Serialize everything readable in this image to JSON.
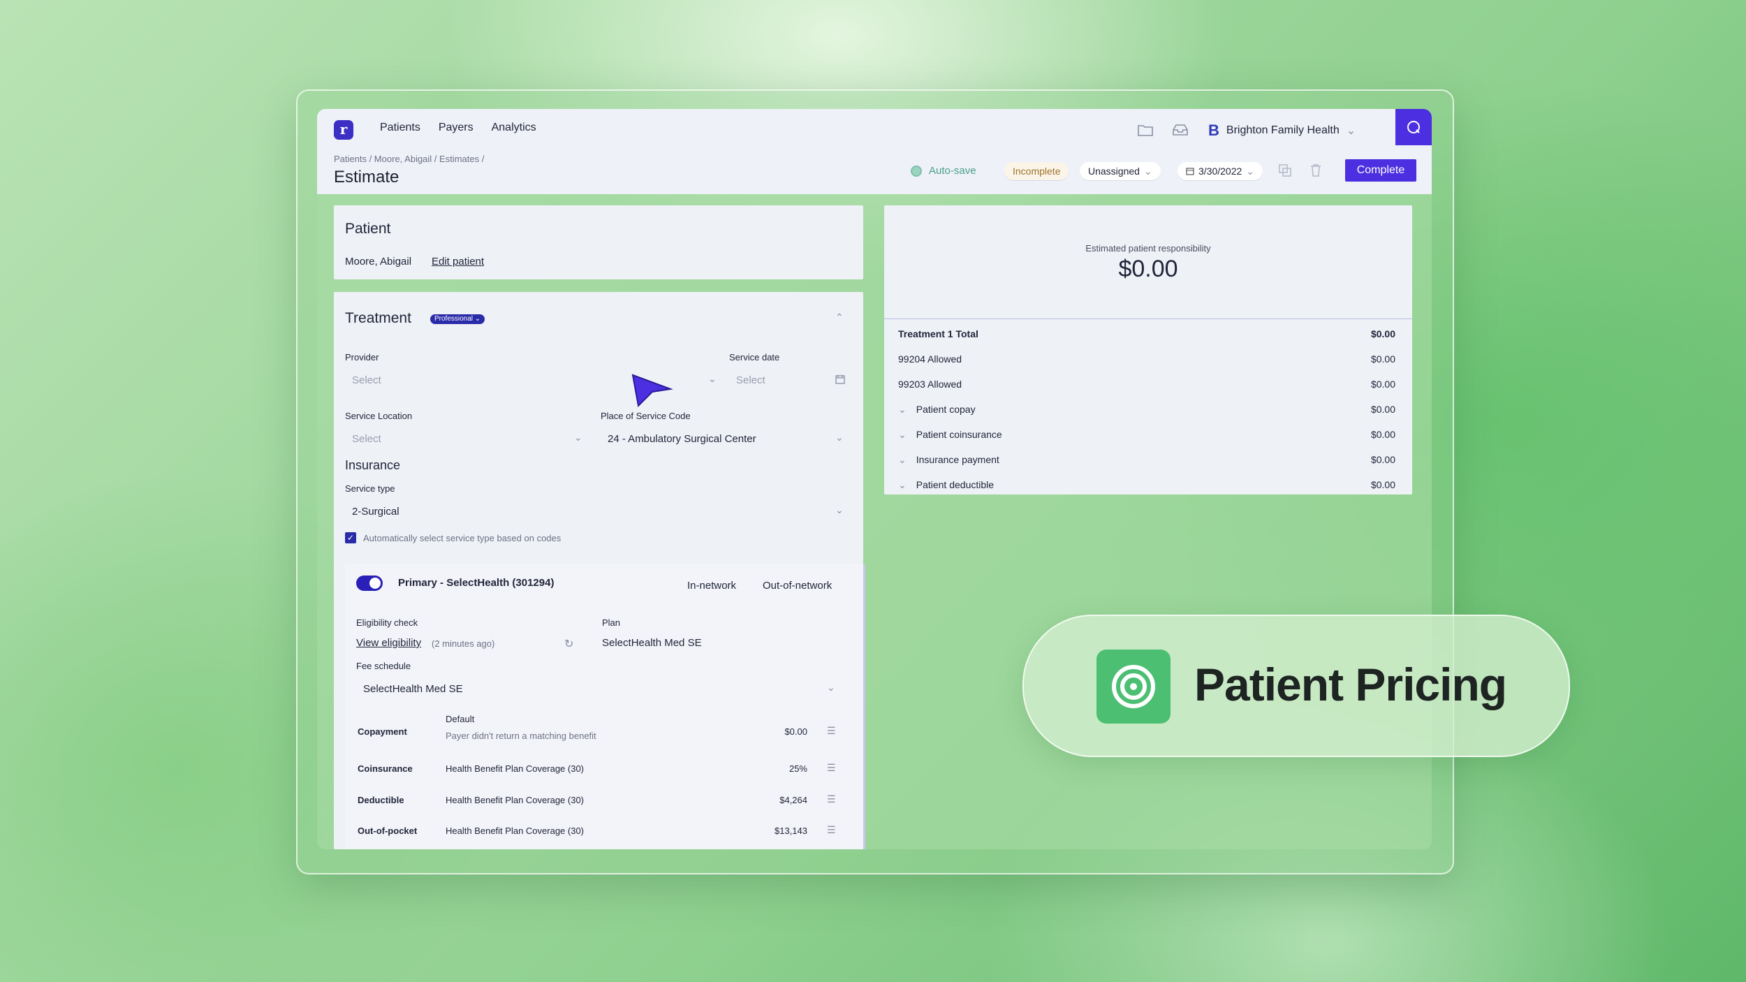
{
  "nav": {
    "logo": "r",
    "items": [
      "Patients",
      "Payers",
      "Analytics"
    ]
  },
  "org": {
    "name": "Brighton Family Health"
  },
  "header": {
    "breadcrumb": "Patients / Moore, Abigail / Estimates /",
    "title": "Estimate",
    "autosave": "Auto-save",
    "status": "Incomplete",
    "assignee": "Unassigned",
    "date": "3/30/2022",
    "complete": "Complete"
  },
  "patient": {
    "heading": "Patient",
    "name": "Moore, Abigail",
    "edit": "Edit patient"
  },
  "treatment": {
    "heading": "Treatment",
    "badge": "Professional",
    "provider_label": "Provider",
    "provider_placeholder": "Select",
    "service_date_label": "Service date",
    "service_date_placeholder": "Select",
    "location_label": "Service Location",
    "location_placeholder": "Select",
    "pos_label": "Place of Service Code",
    "pos_value": "24 - Ambulatory Surgical Center"
  },
  "insurance": {
    "heading": "Insurance",
    "service_type_label": "Service type",
    "service_type_value": "2-Surgical",
    "auto_select": "Automatically select service type based on codes",
    "primary": "Primary - SelectHealth (301294)",
    "in_network": "In-network",
    "out_network": "Out-of-network",
    "eligibility_label": "Eligibility check",
    "view_eligibility": "View eligibility",
    "eligibility_time": "(2 minutes ago)",
    "plan_label": "Plan",
    "plan_value": "SelectHealth Med SE",
    "fee_schedule_label": "Fee schedule",
    "fee_schedule_value": "SelectHealth Med SE",
    "benefits": [
      {
        "name": "Copayment",
        "desc": "Default",
        "sub": "Payer didn't return a matching benefit",
        "amount": "$0.00"
      },
      {
        "name": "Coinsurance",
        "desc": "Health Benefit Plan Coverage (30)",
        "sub": "",
        "amount": "25%"
      },
      {
        "name": "Deductible",
        "desc": "Health Benefit Plan Coverage (30)",
        "sub": "",
        "amount": "$4,264"
      },
      {
        "name": "Out-of-pocket",
        "desc": "Health Benefit Plan Coverage (30)",
        "sub": "",
        "amount": "$13,143"
      }
    ]
  },
  "summary": {
    "caption": "Estimated patient responsibility",
    "total": "$0.00",
    "rows": [
      {
        "label": "Treatment 1 Total",
        "amount": "$0.00"
      },
      {
        "label": "99204 Allowed",
        "amount": "$0.00"
      },
      {
        "label": "99203 Allowed",
        "amount": "$0.00"
      },
      {
        "label": "Patient copay",
        "amount": "$0.00"
      },
      {
        "label": "Patient coinsurance",
        "amount": "$0.00"
      },
      {
        "label": "Insurance payment",
        "amount": "$0.00"
      },
      {
        "label": "Patient deductible",
        "amount": "$0.00"
      }
    ]
  },
  "feature_badge": {
    "label": "Patient Pricing"
  },
  "colors": {
    "accent": "#4b2fe0",
    "brand_green": "#4cbf73"
  }
}
